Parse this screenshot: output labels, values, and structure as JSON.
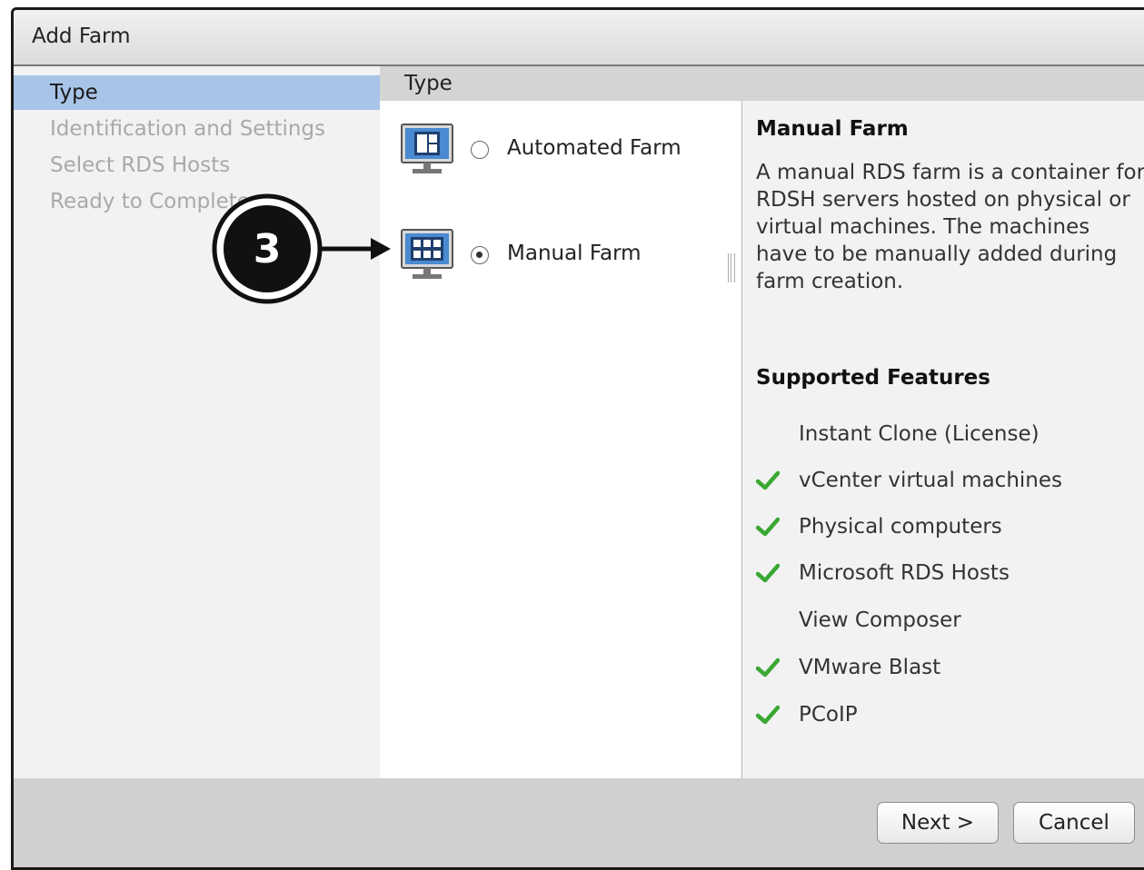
{
  "dialog": {
    "title": "Add Farm"
  },
  "nav": {
    "items": [
      {
        "label": "Type",
        "state": "active"
      },
      {
        "label": "Identification and Settings",
        "state": "inactive"
      },
      {
        "label": "Select RDS Hosts",
        "state": "inactive"
      },
      {
        "label": "Ready to Complete",
        "state": "inactive"
      }
    ]
  },
  "type_header": "Type",
  "options": [
    {
      "label": "Automated Farm",
      "selected": false,
      "icon": "automated-farm-monitor-icon"
    },
    {
      "label": "Manual Farm",
      "selected": true,
      "icon": "manual-farm-monitor-icon"
    }
  ],
  "description": {
    "title": "Manual Farm",
    "text": "A manual RDS farm is a container for RDSH servers hosted on physical or virtual machines. The machines have to be manually added during farm creation.",
    "features_title": "Supported Features",
    "features": [
      {
        "label": "Instant Clone (License)",
        "supported": false
      },
      {
        "label": "vCenter virtual machines",
        "supported": true
      },
      {
        "label": "Physical computers",
        "supported": true
      },
      {
        "label": "Microsoft RDS Hosts",
        "supported": true
      },
      {
        "label": "View Composer",
        "supported": false
      },
      {
        "label": "VMware Blast",
        "supported": true
      },
      {
        "label": "PCoIP",
        "supported": true
      }
    ]
  },
  "footer": {
    "next_label": "Next >",
    "cancel_label": "Cancel"
  },
  "annotation": {
    "step": "3"
  },
  "colors": {
    "active_nav": "#a8c4e8",
    "check": "#3aa832",
    "monitor_blue": "#4a8ad0"
  }
}
